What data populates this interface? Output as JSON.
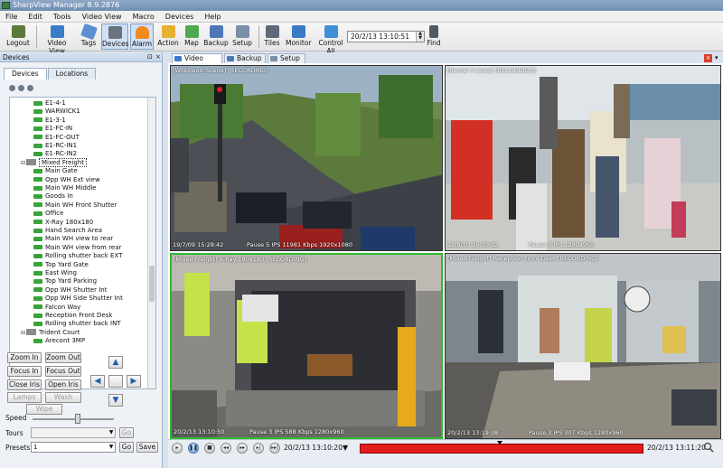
{
  "window": {
    "title": "SharpView Manager 8.9.2876"
  },
  "menu": [
    "File",
    "Edit",
    "Tools",
    "Video View",
    "Macro",
    "Devices",
    "Help"
  ],
  "toolbar": {
    "logout": "Logout",
    "video_view": "Video View",
    "tags": "Tags",
    "devices": "Devices",
    "alarm": "Alarm",
    "action": "Action",
    "map": "Map",
    "backup": "Backup",
    "setup": "Setup",
    "tiles": "Tiles",
    "monitor": "Monitor",
    "control_all": "Control All",
    "datetime": "20/2/13 13:10:51",
    "find": "Find"
  },
  "left_panel": {
    "title": "Devices",
    "tabs": [
      "Devices",
      "Locations"
    ],
    "tree": [
      {
        "label": "E1-4-1",
        "kind": "cam"
      },
      {
        "label": "WARWICK1",
        "kind": "cam"
      },
      {
        "label": "E1-3-1",
        "kind": "cam"
      },
      {
        "label": "E1-FC-IN",
        "kind": "cam"
      },
      {
        "label": "E1-FC-OUT",
        "kind": "cam"
      },
      {
        "label": "E1-RC-IN1",
        "kind": "cam"
      },
      {
        "label": "E1-RC-IN2",
        "kind": "cam"
      },
      {
        "label": "Mixed Freight",
        "kind": "group"
      },
      {
        "label": "Main Gate",
        "kind": "cam"
      },
      {
        "label": "Opp WH Ext view",
        "kind": "cam"
      },
      {
        "label": "Main WH Middle",
        "kind": "cam"
      },
      {
        "label": "Goods In",
        "kind": "cam"
      },
      {
        "label": "Main WH Front Shutter",
        "kind": "cam"
      },
      {
        "label": "Office",
        "kind": "cam"
      },
      {
        "label": "X-Ray 180x180",
        "kind": "cam"
      },
      {
        "label": "Hand Search Area",
        "kind": "cam"
      },
      {
        "label": "Main WH view to rear",
        "kind": "cam"
      },
      {
        "label": "Main WH view from rear",
        "kind": "cam"
      },
      {
        "label": "Rolling shutter back EXT",
        "kind": "cam"
      },
      {
        "label": "Top Yard Gate",
        "kind": "cam"
      },
      {
        "label": "East Wing",
        "kind": "cam"
      },
      {
        "label": "Top Yard Parking",
        "kind": "cam"
      },
      {
        "label": "Opp WH Shutter Int",
        "kind": "cam"
      },
      {
        "label": "Opp WH Side Shutter Int",
        "kind": "cam"
      },
      {
        "label": "Falcon Way",
        "kind": "cam"
      },
      {
        "label": "Reception Front Desk",
        "kind": "cam"
      },
      {
        "label": "Rolling shutter back INT",
        "kind": "cam"
      },
      {
        "label": "Trident Court",
        "kind": "group"
      },
      {
        "label": "Arecont 3MP",
        "kind": "cam"
      }
    ],
    "ptz": {
      "zoom_in": "Zoom In",
      "zoom_out": "Zoom Out",
      "focus_in": "Focus In",
      "focus_out": "Focus Out",
      "close_iris": "Close Iris",
      "open_iris": "Open Iris",
      "lamps": "Lamps",
      "wash": "Wash",
      "wipe": "Wipe"
    },
    "speed_label": "Speed",
    "speed_value": 0.55,
    "tours_label": "Tours",
    "tours_go": "Go",
    "presets_label": "Presets",
    "presets_value": "1",
    "presets_go": "Go",
    "presets_save": "Save"
  },
  "main_tabs": [
    "Video View",
    "Backup",
    "Setup"
  ],
  "feeds": [
    {
      "head": "[Wilkinson_Scene] [RECORDING]",
      "time": "19/7/09 15:28:42",
      "stats": "Pause 5 IPS  11981 Kbps  1920x1080"
    },
    {
      "head": "[Rental 4 Lines] [RECORDING]",
      "time": "12/8/10 16:30:32",
      "stats": "Pause 3 IPS  1280x960"
    },
    {
      "head": "[Mixed Freight] X-Ray 180x180 [RECORDING]",
      "time": "20/2/13 13:10:50",
      "stats": "Pause 3 IPS  588 Kbps  1280x960"
    },
    {
      "head": "[Mixed Freight] Reception Front Desk [RECORDING]",
      "time": "20/2/13 13:19:38",
      "stats": "Pause 3 IPS  307 Kbps  1280x960"
    }
  ],
  "playback": {
    "time": "20/2/13 13:10:20",
    "end_time": "20/2/13 13:11:20",
    "position": 0.49
  },
  "colors": {
    "active_feed_border": "#2dbb2d",
    "timeline": "#e21b1b"
  }
}
